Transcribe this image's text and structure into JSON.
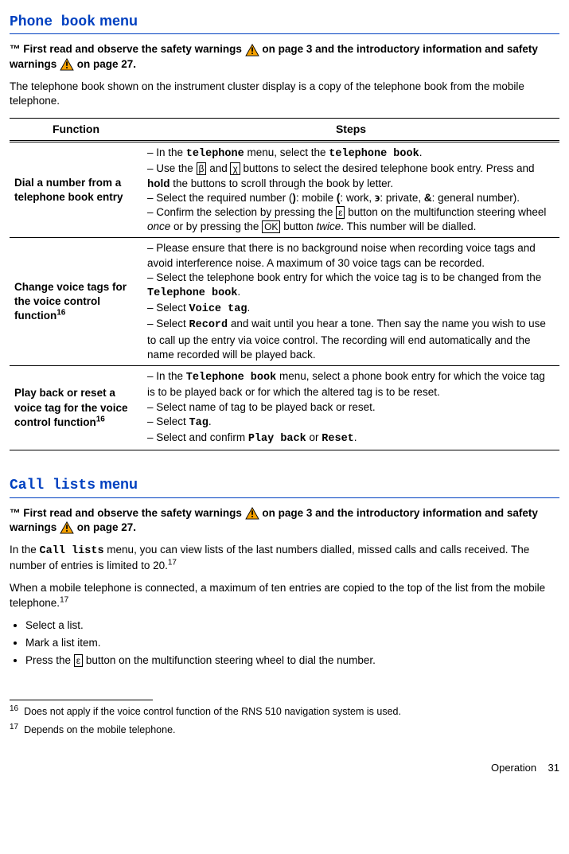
{
  "section1": {
    "title_part1": "Phone book",
    "title_part2": " menu",
    "warn_prefix": "™ First read and observe the safety warnings ",
    "warn_mid": " on page 3 and the introductory information and safety warnings ",
    "warn_suffix": " on page 27.",
    "intro": "The telephone book shown on the instrument cluster display is a copy of the telephone book from the mobile telephone."
  },
  "table": {
    "head_function": "Function",
    "head_steps": "Steps",
    "rows": [
      {
        "func": "Dial a number from a telephone book entry",
        "step1_a": "– In the ",
        "step1_b": "telephone",
        "step1_c": " menu, select the ",
        "step1_d": "telephone book",
        "step1_e": ".",
        "step2_a": "– Use the ",
        "step2_b": "β",
        "step2_c": " and ",
        "step2_d": "χ",
        "step2_e": " buttons to select the desired telephone book entry. Press and ",
        "step2_f": "hold",
        "step2_g": " the buttons to scroll through the book by letter.",
        "step3_a": "– Select the required number (",
        "step3_b": ")",
        "step3_c": ": mobile ",
        "step3_d": "(",
        "step3_e": ": work, ",
        "step3_f": "϶",
        "step3_g": ": private, ",
        "step3_h": "&",
        "step3_i": ": general number).",
        "step4_a": "– Confirm the selection by pressing the ",
        "step4_b": "ε",
        "step4_c": " button on the multifunction steering wheel ",
        "step4_d": "once",
        "step4_e": " or by pressing the ",
        "step4_f": "OK",
        "step4_g": " button ",
        "step4_h": "twice",
        "step4_i": ". This number will be dialled."
      },
      {
        "func_a": "Change voice tags for the voice control function",
        "func_sup": "16",
        "step1": "– Please ensure that there is no background noise when recording voice tags and avoid interference noise. A maximum of 30 voice tags can be recorded.",
        "step2_a": "– Select the telephone book entry for which the voice tag is to be changed from the ",
        "step2_b": "Telephone book",
        "step2_c": ".",
        "step3_a": "– Select ",
        "step3_b": "Voice tag",
        "step3_c": ".",
        "step4_a": "– Select ",
        "step4_b": "Record",
        "step4_c": " and wait until you hear a tone. Then say the name you wish to use to call up the entry via voice control. The recording will end automatically and the name recorded will be played back."
      },
      {
        "func_a": "Play back or reset a voice tag for the voice control function",
        "func_sup": "16",
        "step1_a": "– In the ",
        "step1_b": "Telephone book",
        "step1_c": " menu, select a phone book entry for which the voice tag is to be played back or for which the altered tag is to be reset.",
        "step2": "– Select name of tag to be played back or reset.",
        "step3_a": "– Select ",
        "step3_b": "Tag",
        "step3_c": ".",
        "step4_a": "– Select and confirm ",
        "step4_b": "Play back",
        "step4_c": " or ",
        "step4_d": "Reset",
        "step4_e": "."
      }
    ]
  },
  "section2": {
    "title_mono": "Call lists",
    "title_rest": " menu",
    "warn_prefix": "™ First read and observe the safety warnings ",
    "warn_mid": " on page 3 and the introductory information and safety warnings ",
    "warn_suffix": " on page 27.",
    "p1_a": "In the ",
    "p1_b": "Call lists",
    "p1_c": " menu, you can view lists of the last numbers dialled, missed calls and calls received. The number of entries is limited to 20.",
    "p1_sup": "17",
    "p2_a": "When a mobile telephone is connected, a maximum of ten entries are copied to the top of the list from the mobile telephone.",
    "p2_sup": "17",
    "bullets": [
      "Select a list.",
      "Mark a list item."
    ],
    "bullet3_a": "Press the ",
    "bullet3_b": "ε",
    "bullet3_c": " button on the multifunction steering wheel to dial the number."
  },
  "footnotes": {
    "fn16_num": "16",
    "fn16": "Does not apply if the voice control function of the RNS 510 navigation system is used.",
    "fn17_num": "17",
    "fn17": "Depends on the mobile telephone."
  },
  "footer": {
    "label": "Operation",
    "page": "31"
  }
}
